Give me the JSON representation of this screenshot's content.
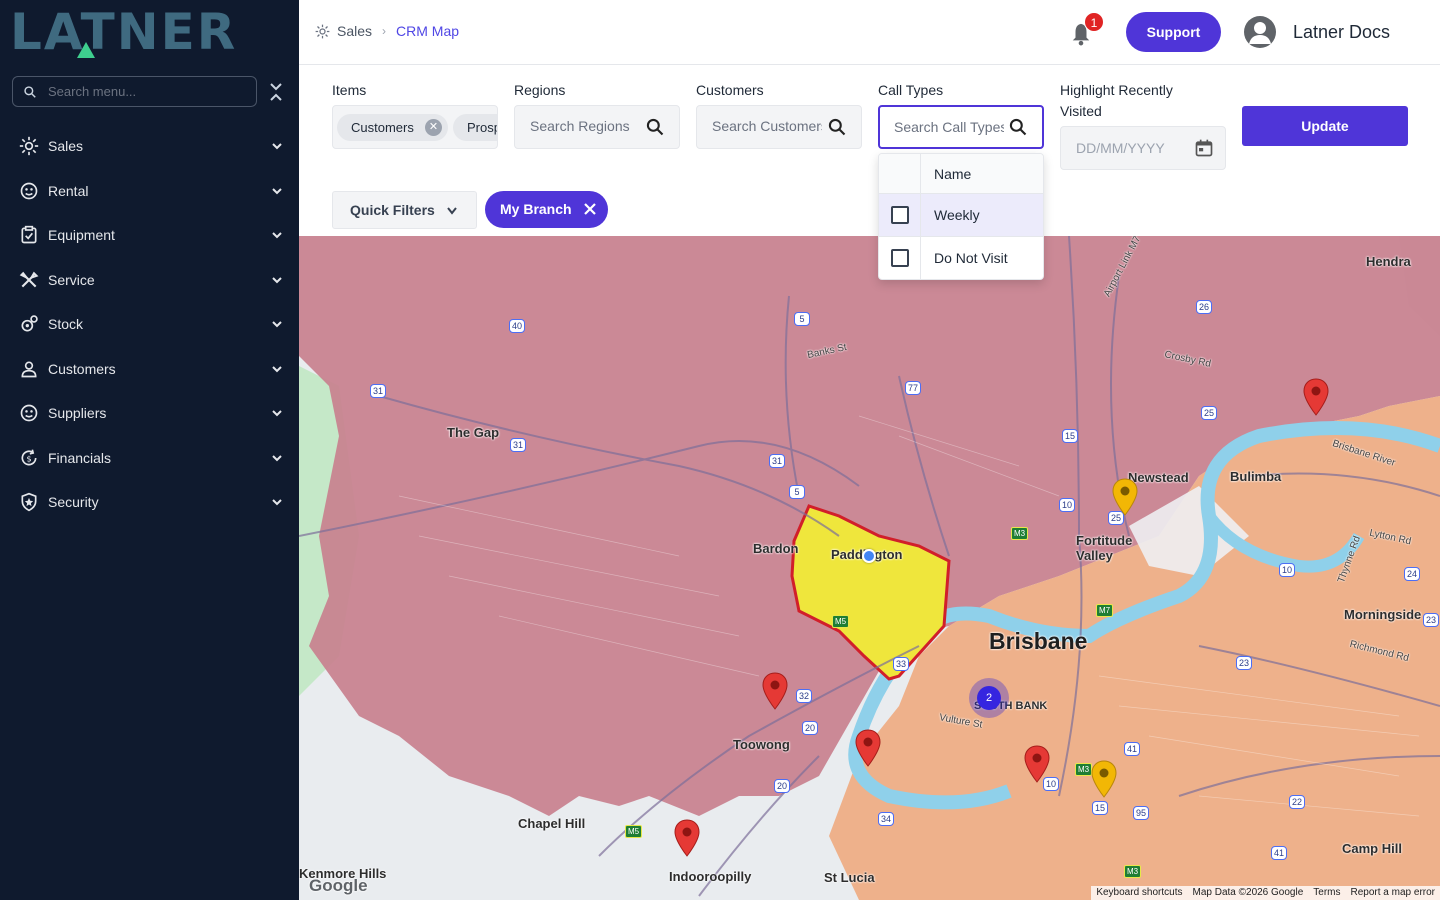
{
  "brand": {
    "logo_text": "LATNER"
  },
  "sidebar": {
    "search_placeholder": "Search menu...",
    "items": [
      {
        "label": "Sales",
        "icon": "sales-icon"
      },
      {
        "label": "Rental",
        "icon": "rental-icon"
      },
      {
        "label": "Equipment",
        "icon": "equipment-icon"
      },
      {
        "label": "Service",
        "icon": "service-icon"
      },
      {
        "label": "Stock",
        "icon": "stock-icon"
      },
      {
        "label": "Customers",
        "icon": "customers-icon"
      },
      {
        "label": "Suppliers",
        "icon": "suppliers-icon"
      },
      {
        "label": "Financials",
        "icon": "financials-icon"
      },
      {
        "label": "Security",
        "icon": "security-icon"
      }
    ]
  },
  "header": {
    "breadcrumb": [
      "Sales",
      "CRM Map"
    ],
    "notification_count": "1",
    "support_label": "Support",
    "user_name": "Latner Docs"
  },
  "filters": {
    "items": {
      "label": "Items",
      "chips": [
        "Customers",
        "Prospects"
      ]
    },
    "regions": {
      "label": "Regions",
      "placeholder": "Search Regions"
    },
    "customers": {
      "label": "Customers",
      "placeholder": "Search Customers"
    },
    "call_types": {
      "label": "Call Types",
      "placeholder": "Search Call Types"
    },
    "highlight": {
      "label": "Highlight Recently Visited",
      "placeholder": "DD/MM/YYYY"
    },
    "update_label": "Update",
    "quick_filters_label": "Quick Filters",
    "active_filter_chip": "My Branch"
  },
  "call_types_dropdown": {
    "column_header": "Name",
    "options": [
      {
        "label": "Weekly",
        "checked": false,
        "highlighted": true
      },
      {
        "label": "Do Not Visit",
        "checked": false,
        "highlighted": false
      }
    ]
  },
  "map": {
    "labels": {
      "brisbane": "Brisbane",
      "the_gap": "The Gap",
      "bardon": "Bardon",
      "paddington": "Paddington",
      "toowong": "Toowong",
      "chapel_hill": "Chapel Hill",
      "kenmore_hills": "Kenmore Hills",
      "indooroopilly": "Indooroopilly",
      "st_lucia": "St Lucia",
      "south_bank": "SOUTH BANK",
      "newstead": "Newstead",
      "fortitude_valley": "Fortitude Valley",
      "bulimba": "Bulimba",
      "morningside": "Morningside",
      "camp_hill": "Camp Hill",
      "hendra": "Hendra",
      "brisbane_river": "Brisbane River",
      "banks_st": "Banks St",
      "crosby_rd": "Crosby Rd",
      "lytton_rd": "Lytton Rd",
      "richmond_rd": "Richmond Rd",
      "vulture_st": "Vulture St",
      "thynne_rd": "Thynne Rd",
      "airport_link": "Airport Link M7"
    },
    "cluster_count": "2",
    "route_shields": [
      "40",
      "5",
      "31",
      "31",
      "77",
      "31",
      "5",
      "15",
      "10",
      "25",
      "26",
      "25",
      "10",
      "24",
      "23",
      "23",
      "32",
      "20",
      "33",
      "20",
      "34",
      "41",
      "10",
      "15",
      "95",
      "22",
      "41"
    ],
    "motorway_shields": [
      "M3",
      "M7",
      "M5",
      "M3",
      "M5",
      "M3"
    ],
    "attribution": {
      "google": "Google",
      "keyboard": "Keyboard shortcuts",
      "map_data": "Map Data ©2026 Google",
      "terms": "Terms",
      "report": "Report a map error"
    },
    "colors": {
      "branch_region": "#c8808e",
      "other_region": "#eeae85",
      "selected_region": "#efe63c",
      "river": "#8fd0ea",
      "pin_red": "#e53935",
      "pin_yellow": "#f2b705"
    }
  }
}
